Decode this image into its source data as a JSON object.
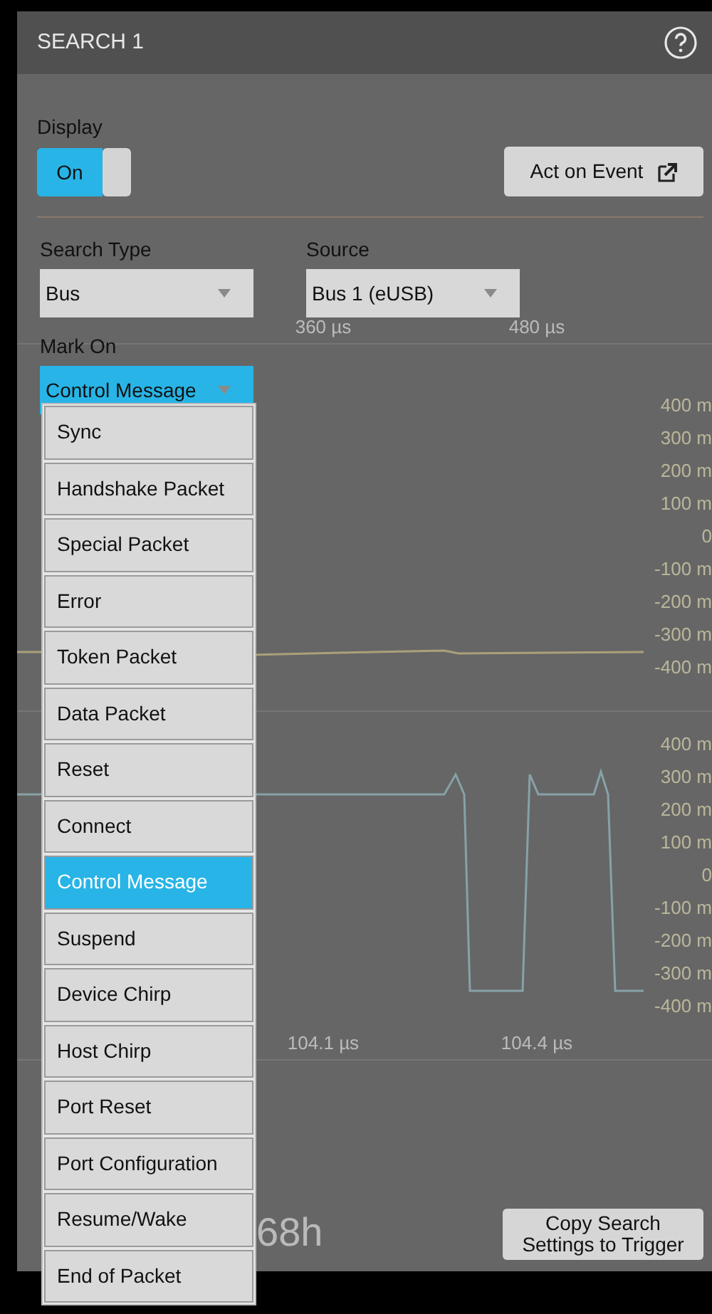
{
  "panel": {
    "title": "SEARCH 1",
    "display": {
      "label": "Display",
      "on": true,
      "text": "On"
    },
    "act_on_event": "Act on Event",
    "search_type": {
      "label": "Search Type",
      "value": "Bus"
    },
    "source": {
      "label": "Source",
      "value": "Bus 1 (eUSB)"
    },
    "mark_on": {
      "label": "Mark On",
      "value": "Control Message",
      "expanded": true,
      "options": [
        {
          "label": "Sync",
          "selected": false
        },
        {
          "label": "Handshake Packet",
          "selected": false
        },
        {
          "label": "Special Packet",
          "selected": false
        },
        {
          "label": "Error",
          "selected": false
        },
        {
          "label": "Token Packet",
          "selected": false
        },
        {
          "label": "Data Packet",
          "selected": false
        },
        {
          "label": "Reset",
          "selected": false
        },
        {
          "label": "Connect",
          "selected": false
        },
        {
          "label": "Control Message",
          "selected": true
        },
        {
          "label": "Suspend",
          "selected": false
        },
        {
          "label": "Device Chirp",
          "selected": false
        },
        {
          "label": "Host Chirp",
          "selected": false
        },
        {
          "label": "Port Reset",
          "selected": false
        },
        {
          "label": "Port Configuration",
          "selected": false
        },
        {
          "label": "Resume/Wake",
          "selected": false
        },
        {
          "label": "End of Packet",
          "selected": false
        }
      ]
    },
    "copy_button": "Copy Search Settings to Trigger"
  },
  "background": {
    "panes": [
      {
        "x_labels": [
          "360 µs",
          "480 µs"
        ]
      },
      {
        "y_labels": [
          "400 m",
          "300 m",
          "200 m",
          "100 m",
          "0",
          "-100 m",
          "-200 m",
          "-300 m",
          "-400 m"
        ]
      },
      {
        "y_labels": [
          "400 m",
          "300 m",
          "200 m",
          "100 m",
          "0",
          "-100 m",
          "-200 m",
          "-300 m",
          "-400 m"
        ],
        "x_labels": [
          "104.1 µs",
          "104.4 µs"
        ]
      }
    ],
    "readout": "68h"
  }
}
